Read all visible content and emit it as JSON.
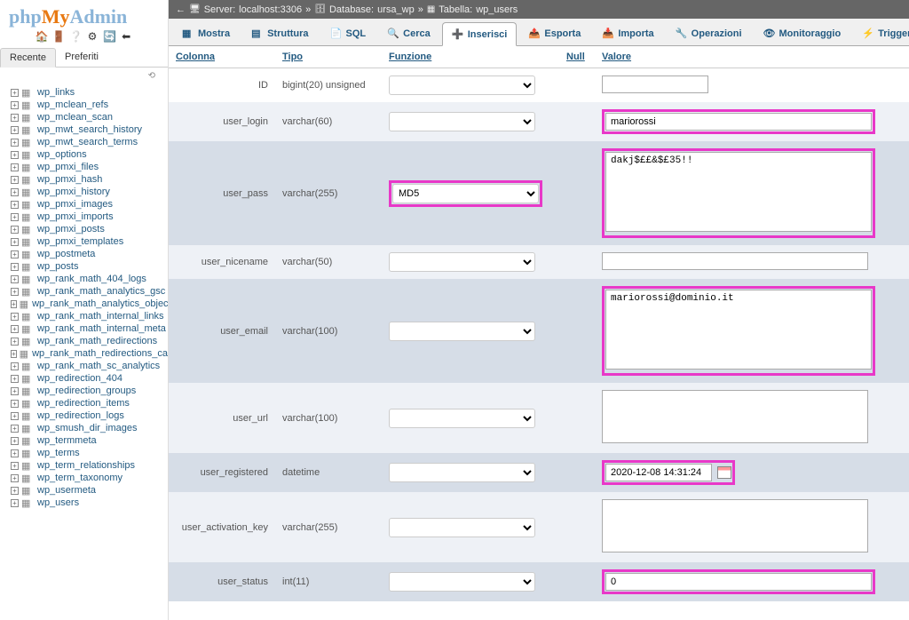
{
  "logo": {
    "part1": "php",
    "part2": "My",
    "part3": "Admin"
  },
  "sidebar_tabs": {
    "recent": "Recente",
    "favorites": "Preferiti"
  },
  "tree": [
    "wp_links",
    "wp_mclean_refs",
    "wp_mclean_scan",
    "wp_mwt_search_history",
    "wp_mwt_search_terms",
    "wp_options",
    "wp_pmxi_files",
    "wp_pmxi_hash",
    "wp_pmxi_history",
    "wp_pmxi_images",
    "wp_pmxi_imports",
    "wp_pmxi_posts",
    "wp_pmxi_templates",
    "wp_postmeta",
    "wp_posts",
    "wp_rank_math_404_logs",
    "wp_rank_math_analytics_gsc",
    "wp_rank_math_analytics_objects",
    "wp_rank_math_internal_links",
    "wp_rank_math_internal_meta",
    "wp_rank_math_redirections",
    "wp_rank_math_redirections_cache",
    "wp_rank_math_sc_analytics",
    "wp_redirection_404",
    "wp_redirection_groups",
    "wp_redirection_items",
    "wp_redirection_logs",
    "wp_smush_dir_images",
    "wp_termmeta",
    "wp_terms",
    "wp_term_relationships",
    "wp_term_taxonomy",
    "wp_usermeta",
    "wp_users"
  ],
  "breadcrumb": {
    "server_label": "Server:",
    "server": "localhost:3306",
    "db_label": "Database:",
    "db": "ursa_wp",
    "table_label": "Tabella:",
    "table": "wp_users"
  },
  "tabs": {
    "browse": "Mostra",
    "structure": "Struttura",
    "sql": "SQL",
    "search": "Cerca",
    "insert": "Inserisci",
    "export": "Esporta",
    "import": "Importa",
    "operations": "Operazioni",
    "tracking": "Monitoraggio",
    "triggers": "Trigger"
  },
  "headers": {
    "column": "Colonna",
    "type": "Tipo",
    "function": "Funzione",
    "null": "Null",
    "value": "Valore"
  },
  "rows": [
    {
      "name": "ID",
      "type": "bigint(20) unsigned",
      "func": "",
      "val": "",
      "highlight": false,
      "kind": "input",
      "rowclass": "row-first"
    },
    {
      "name": "user_login",
      "type": "varchar(60)",
      "func": "",
      "val": "mariorossi",
      "highlight": true,
      "kind": "input",
      "rowclass": "row-odd"
    },
    {
      "name": "user_pass",
      "type": "varchar(255)",
      "func": "MD5",
      "val": "dakj$££&$£35!!",
      "highlight": true,
      "kind": "textarea",
      "funchighlight": true,
      "rowclass": "row-even"
    },
    {
      "name": "user_nicename",
      "type": "varchar(50)",
      "func": "",
      "val": "",
      "highlight": false,
      "kind": "input",
      "rowclass": "row-odd"
    },
    {
      "name": "user_email",
      "type": "varchar(100)",
      "func": "",
      "val": "mariorossi@dominio.it",
      "highlight": true,
      "kind": "textarea",
      "rowclass": "row-even"
    },
    {
      "name": "user_url",
      "type": "varchar(100)",
      "func": "",
      "val": "",
      "highlight": false,
      "kind": "textarea-short",
      "rowclass": "row-odd"
    },
    {
      "name": "user_registered",
      "type": "datetime",
      "func": "",
      "val": "2020-12-08 14:31:24",
      "highlight": true,
      "kind": "date",
      "rowclass": "row-even"
    },
    {
      "name": "user_activation_key",
      "type": "varchar(255)",
      "func": "",
      "val": "",
      "highlight": false,
      "kind": "textarea-short",
      "rowclass": "row-odd"
    },
    {
      "name": "user_status",
      "type": "int(11)",
      "func": "",
      "val": "0",
      "highlight": true,
      "kind": "input",
      "rowclass": "row-even"
    }
  ]
}
